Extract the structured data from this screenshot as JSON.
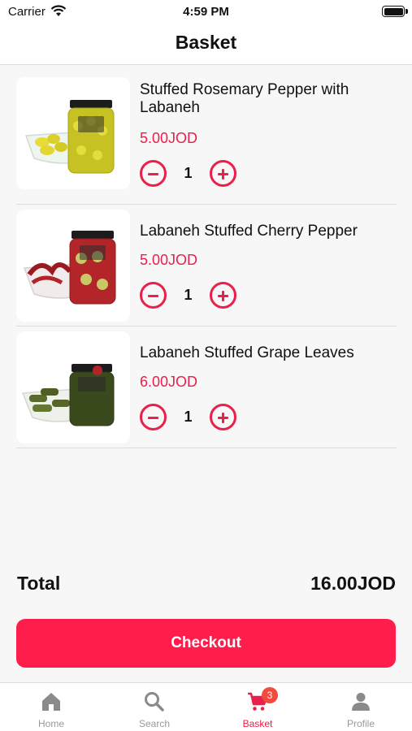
{
  "status_bar": {
    "carrier": "Carrier",
    "time": "4:59 PM"
  },
  "header": {
    "title": "Basket"
  },
  "items": [
    {
      "name": "Stuffed Rosemary Pepper with Labaneh",
      "price": "5.00JOD",
      "quantity": "1"
    },
    {
      "name": "Labaneh Stuffed Cherry Pepper",
      "price": "5.00JOD",
      "quantity": "1"
    },
    {
      "name": "Labaneh Stuffed Grape Leaves",
      "price": "6.00JOD",
      "quantity": "1"
    }
  ],
  "summary": {
    "total_label": "Total",
    "total_value": "16.00JOD"
  },
  "checkout": {
    "label": "Checkout"
  },
  "tabs": [
    {
      "label": "Home",
      "icon": "home-icon"
    },
    {
      "label": "Search",
      "icon": "search-icon"
    },
    {
      "label": "Basket",
      "icon": "cart-icon",
      "badge": "3",
      "active": true
    },
    {
      "label": "Profile",
      "icon": "person-icon"
    }
  ],
  "colors": {
    "accent": "#e8204a",
    "checkout": "#ff1d4b",
    "badge": "#f24a3c",
    "inactive_tab": "#999999"
  }
}
